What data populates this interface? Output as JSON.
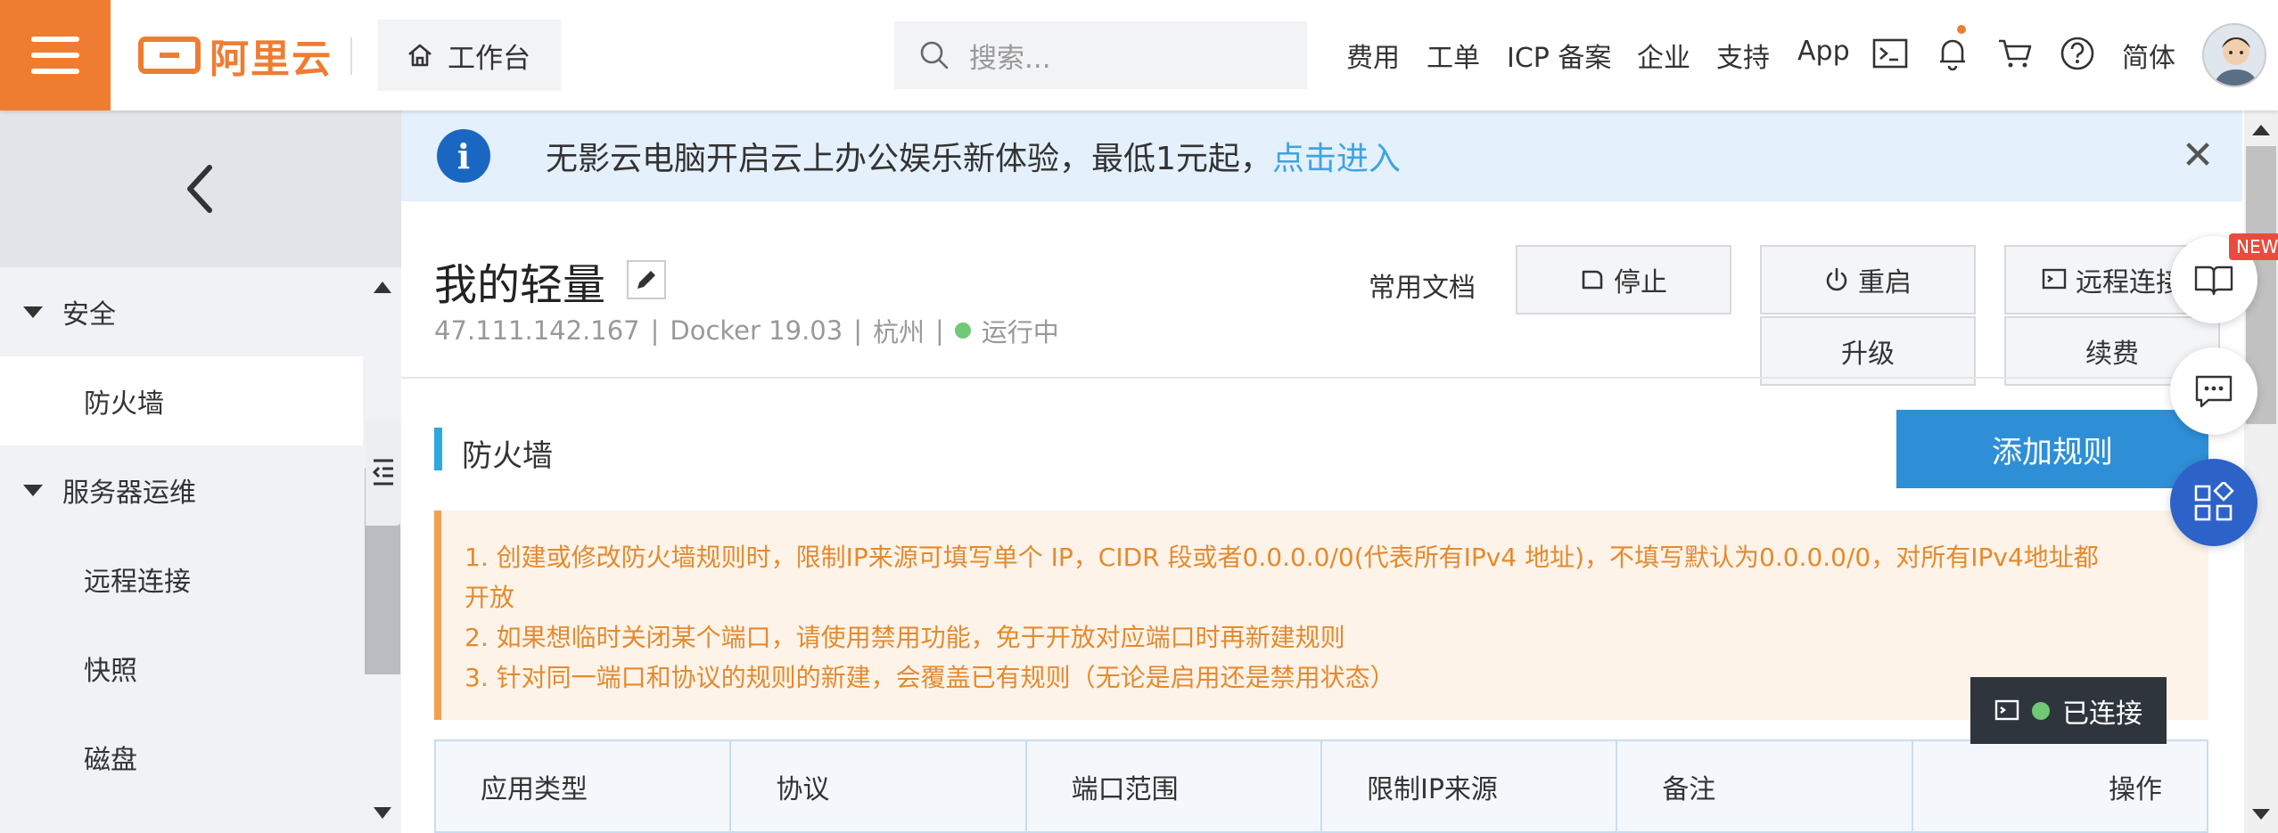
{
  "header": {
    "logo_text": "阿里云",
    "workbench_label": "工作台",
    "search_placeholder": "搜索...",
    "nav": [
      "费用",
      "工单",
      "ICP 备案",
      "企业",
      "支持",
      "App"
    ],
    "lang_label": "简体"
  },
  "notice": {
    "message": "无影云电脑开启云上办公娱乐新体验，最低1元起，",
    "link": "点击进入"
  },
  "sidebar": {
    "groups": [
      {
        "label": "安全",
        "items": [
          {
            "label": "防火墙",
            "active": true
          }
        ]
      },
      {
        "label": "服务器运维",
        "items": [
          {
            "label": "远程连接"
          },
          {
            "label": "快照"
          },
          {
            "label": "磁盘"
          }
        ]
      }
    ]
  },
  "instance": {
    "name": "我的轻量",
    "ip": "47.111.142.167",
    "image": "Docker 19.03",
    "region": "杭州",
    "status": "运行中",
    "status_color": "#6fc977"
  },
  "actions": {
    "docs": "常用文档",
    "stop": "停止",
    "restart": "重启",
    "remote": "远程连接",
    "upgrade": "升级",
    "renew": "续费"
  },
  "firewall": {
    "title": "防火墙",
    "add_rule": "添加规则",
    "tips": [
      "1. 创建或修改防火墙规则时，限制IP来源可填写单个 IP，CIDR 段或者0.0.0.0/0(代表所有IPv4 地址)，不填写默认为0.0.0.0/0，对所有IPv4地址都",
      "开放",
      "2. 如果想临时关闭某个端口，请使用禁用功能，免于开放对应端口时再新建规则",
      "3. 针对同一端口和协议的规则的新建，会覆盖已有规则（无论是启用还是禁用状态）"
    ],
    "columns": [
      "应用类型",
      "协议",
      "端口范围",
      "限制IP来源",
      "备注",
      "操作"
    ]
  },
  "floating": {
    "new_badge": "NEW",
    "connection_status": "已连接"
  },
  "colors": {
    "brand": "#ee7d32",
    "primary": "#2e8fd6",
    "link": "#3ea4e0",
    "tips_text": "#e48a2e"
  }
}
